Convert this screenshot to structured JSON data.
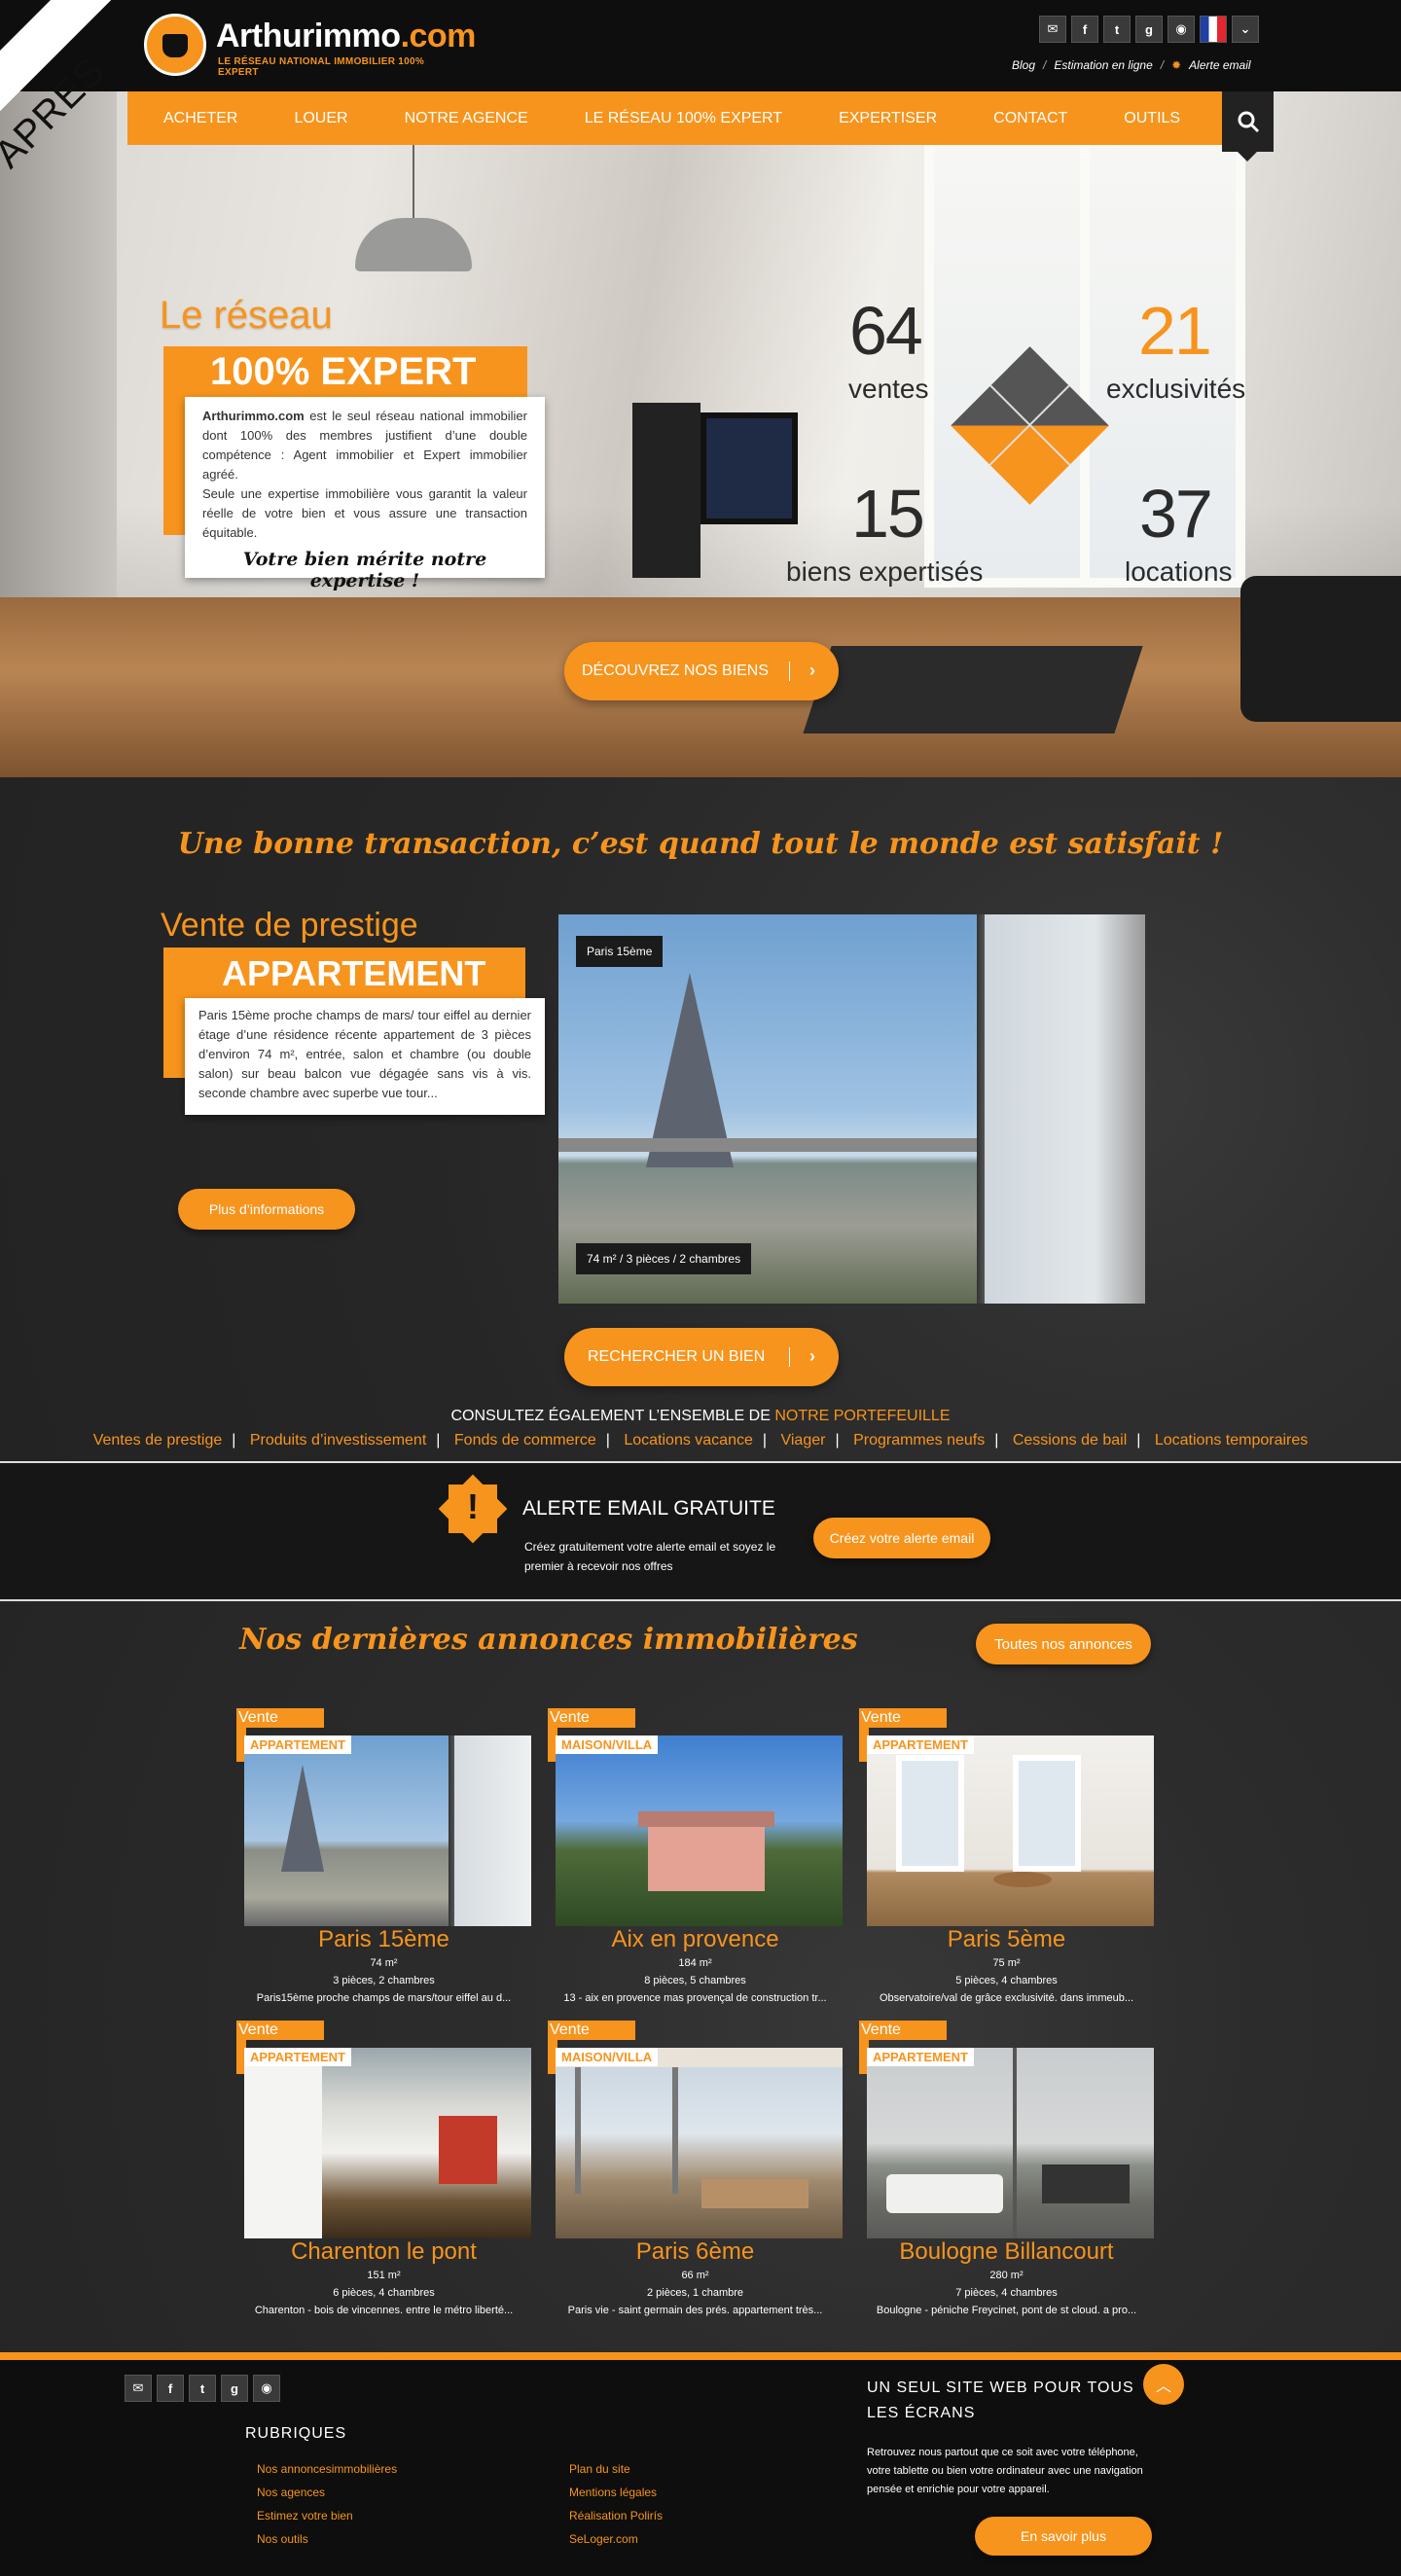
{
  "header": {
    "logo_name": "Arthurimmo",
    "logo_domain": ".com",
    "logo_tagline": "LE RÉSEAU NATIONAL IMMOBILIER 100% EXPERT",
    "social_icons": [
      "mail-icon",
      "facebook-icon",
      "twitter-icon",
      "google-plus-icon",
      "rss-icon",
      "french-flag-icon",
      "chevron-down-icon"
    ],
    "links": [
      "Blog",
      "Estimation en ligne",
      "Alerte email"
    ]
  },
  "nav": {
    "items": [
      "Acheter",
      "Louer",
      "Notre agence",
      "Le réseau 100% expert",
      "Expertiser",
      "Contact",
      "Outils"
    ]
  },
  "hero": {
    "corner_label": "APRES",
    "reseau": "Le réseau",
    "expert": "100% EXPERT",
    "brand": "Arthurimmo.com",
    "text1": " est le seul réseau national immobilier dont 100% des membres justifient d’une double compétence : Agent immobilier et Expert immobilier agréé.",
    "text2": "Seule une expertise immobilière vous garantit la valeur réelle de votre bien et vous assure une transaction équitable.",
    "motto": "Votre bien mérite notre expertise !",
    "cta": "Découvrez nos biens",
    "stats": [
      {
        "value": "64",
        "label": "ventes"
      },
      {
        "value": "21",
        "label": "exclusivités"
      },
      {
        "value": "15",
        "label": "biens expertisés"
      },
      {
        "value": "37",
        "label": "locations"
      }
    ]
  },
  "prestige": {
    "tagline": "Une bonne transaction, c’est quand tout le monde est satisfait !",
    "title": "Vente de prestige",
    "type": "APPARTEMENT",
    "description": "Paris 15ème proche champs de mars/ tour eiffel au dernier étage d’une résidence récente appartement de 3 pièces d’environ 74 m², entrée, salon et chambre (ou double salon) sur beau balcon vue dégagée sans vis à vis. seconde chambre avec superbe vue tour...",
    "more_info": "Plus d’informations",
    "photo_location": "Paris 15ème",
    "photo_details": "74 m² / 3 pièces / 2 chambres",
    "search_cta": "Rechercher un bien",
    "portfolio_text": "Consultez également l’ensemble de ",
    "portfolio_link": "notre portefeuille",
    "portfolio_links": [
      "Ventes de prestige",
      "Produits d’investissement",
      "Fonds de commerce",
      "Locations vacance",
      "Viager",
      "Programmes neufs",
      "Cessions de bail",
      "Locations temporaires"
    ]
  },
  "alert": {
    "title": "Alerte email gratuite",
    "desc": "Créez gratuitement votre alerte email et soyez le premier à recevoir nos offres",
    "button": "Créez votre alerte email"
  },
  "listings": {
    "title": "Nos dernières annonces immobilières",
    "all_button": "Toutes nos annonces",
    "items": [
      {
        "tag": "Vente",
        "type": "APPARTEMENT",
        "city": "Paris 15ème",
        "surface": "74 m²",
        "rooms": "3 pièces, 2 chambres",
        "desc": "Paris15ème proche champs de mars/tour eiffel au d..."
      },
      {
        "tag": "Vente",
        "type": "MAISON/VILLA",
        "city": "Aix en provence",
        "surface": "184 m²",
        "rooms": "8 pièces, 5 chambres",
        "desc": "13 - aix en provence mas provençal de construction tr..."
      },
      {
        "tag": "Vente",
        "type": "APPARTEMENT",
        "city": "Paris 5ème",
        "surface": "75 m²",
        "rooms": "5 pièces, 4 chambres",
        "desc": "Observatoire/val de grâce exclusivité. dans immeub..."
      },
      {
        "tag": "Vente",
        "type": "APPARTEMENT",
        "city": "Charenton le pont",
        "surface": "151 m²",
        "rooms": "6 pièces, 4 chambres",
        "desc": "Charenton - bois de vincennes. entre le métro liberté..."
      },
      {
        "tag": "Vente",
        "type": "MAISON/VILLA",
        "city": "Paris 6ème",
        "surface": "66 m²",
        "rooms": "2 pièces, 1 chambre",
        "desc": "Paris vie - saint germain des prés. appartement très..."
      },
      {
        "tag": "Vente",
        "type": "APPARTEMENT",
        "city": "Boulogne Billancourt",
        "surface": "280 m²",
        "rooms": "7 pièces, 4 chambres",
        "desc": "Boulogne - péniche Freycinet, pont de st cloud. a pro..."
      }
    ]
  },
  "footer": {
    "social_icons": [
      "mail-icon",
      "facebook-icon",
      "twitter-icon",
      "google-plus-icon",
      "rss-icon"
    ],
    "rubriques": "Rubriques",
    "col1": [
      "Nos annoncesimmobilières",
      "Nos agences",
      "Estimez votre bien",
      "Nos outils"
    ],
    "col2": [
      "Plan du site",
      "Mentions légales",
      "Réalisation Polirís",
      "SeLoger.com"
    ],
    "right_title": "Un seul site web pour tous les écrans",
    "right_desc": "Retrouvez nous partout que ce soit avec votre téléphone, votre tablette ou bien votre ordinateur avec une navigation pensée et enrichie pour votre appareil.",
    "right_button": "En savoir plus"
  },
  "colors": {
    "accent": "#f7941d",
    "dark": "#0e0e0e",
    "panel": "#2a2a2a"
  }
}
